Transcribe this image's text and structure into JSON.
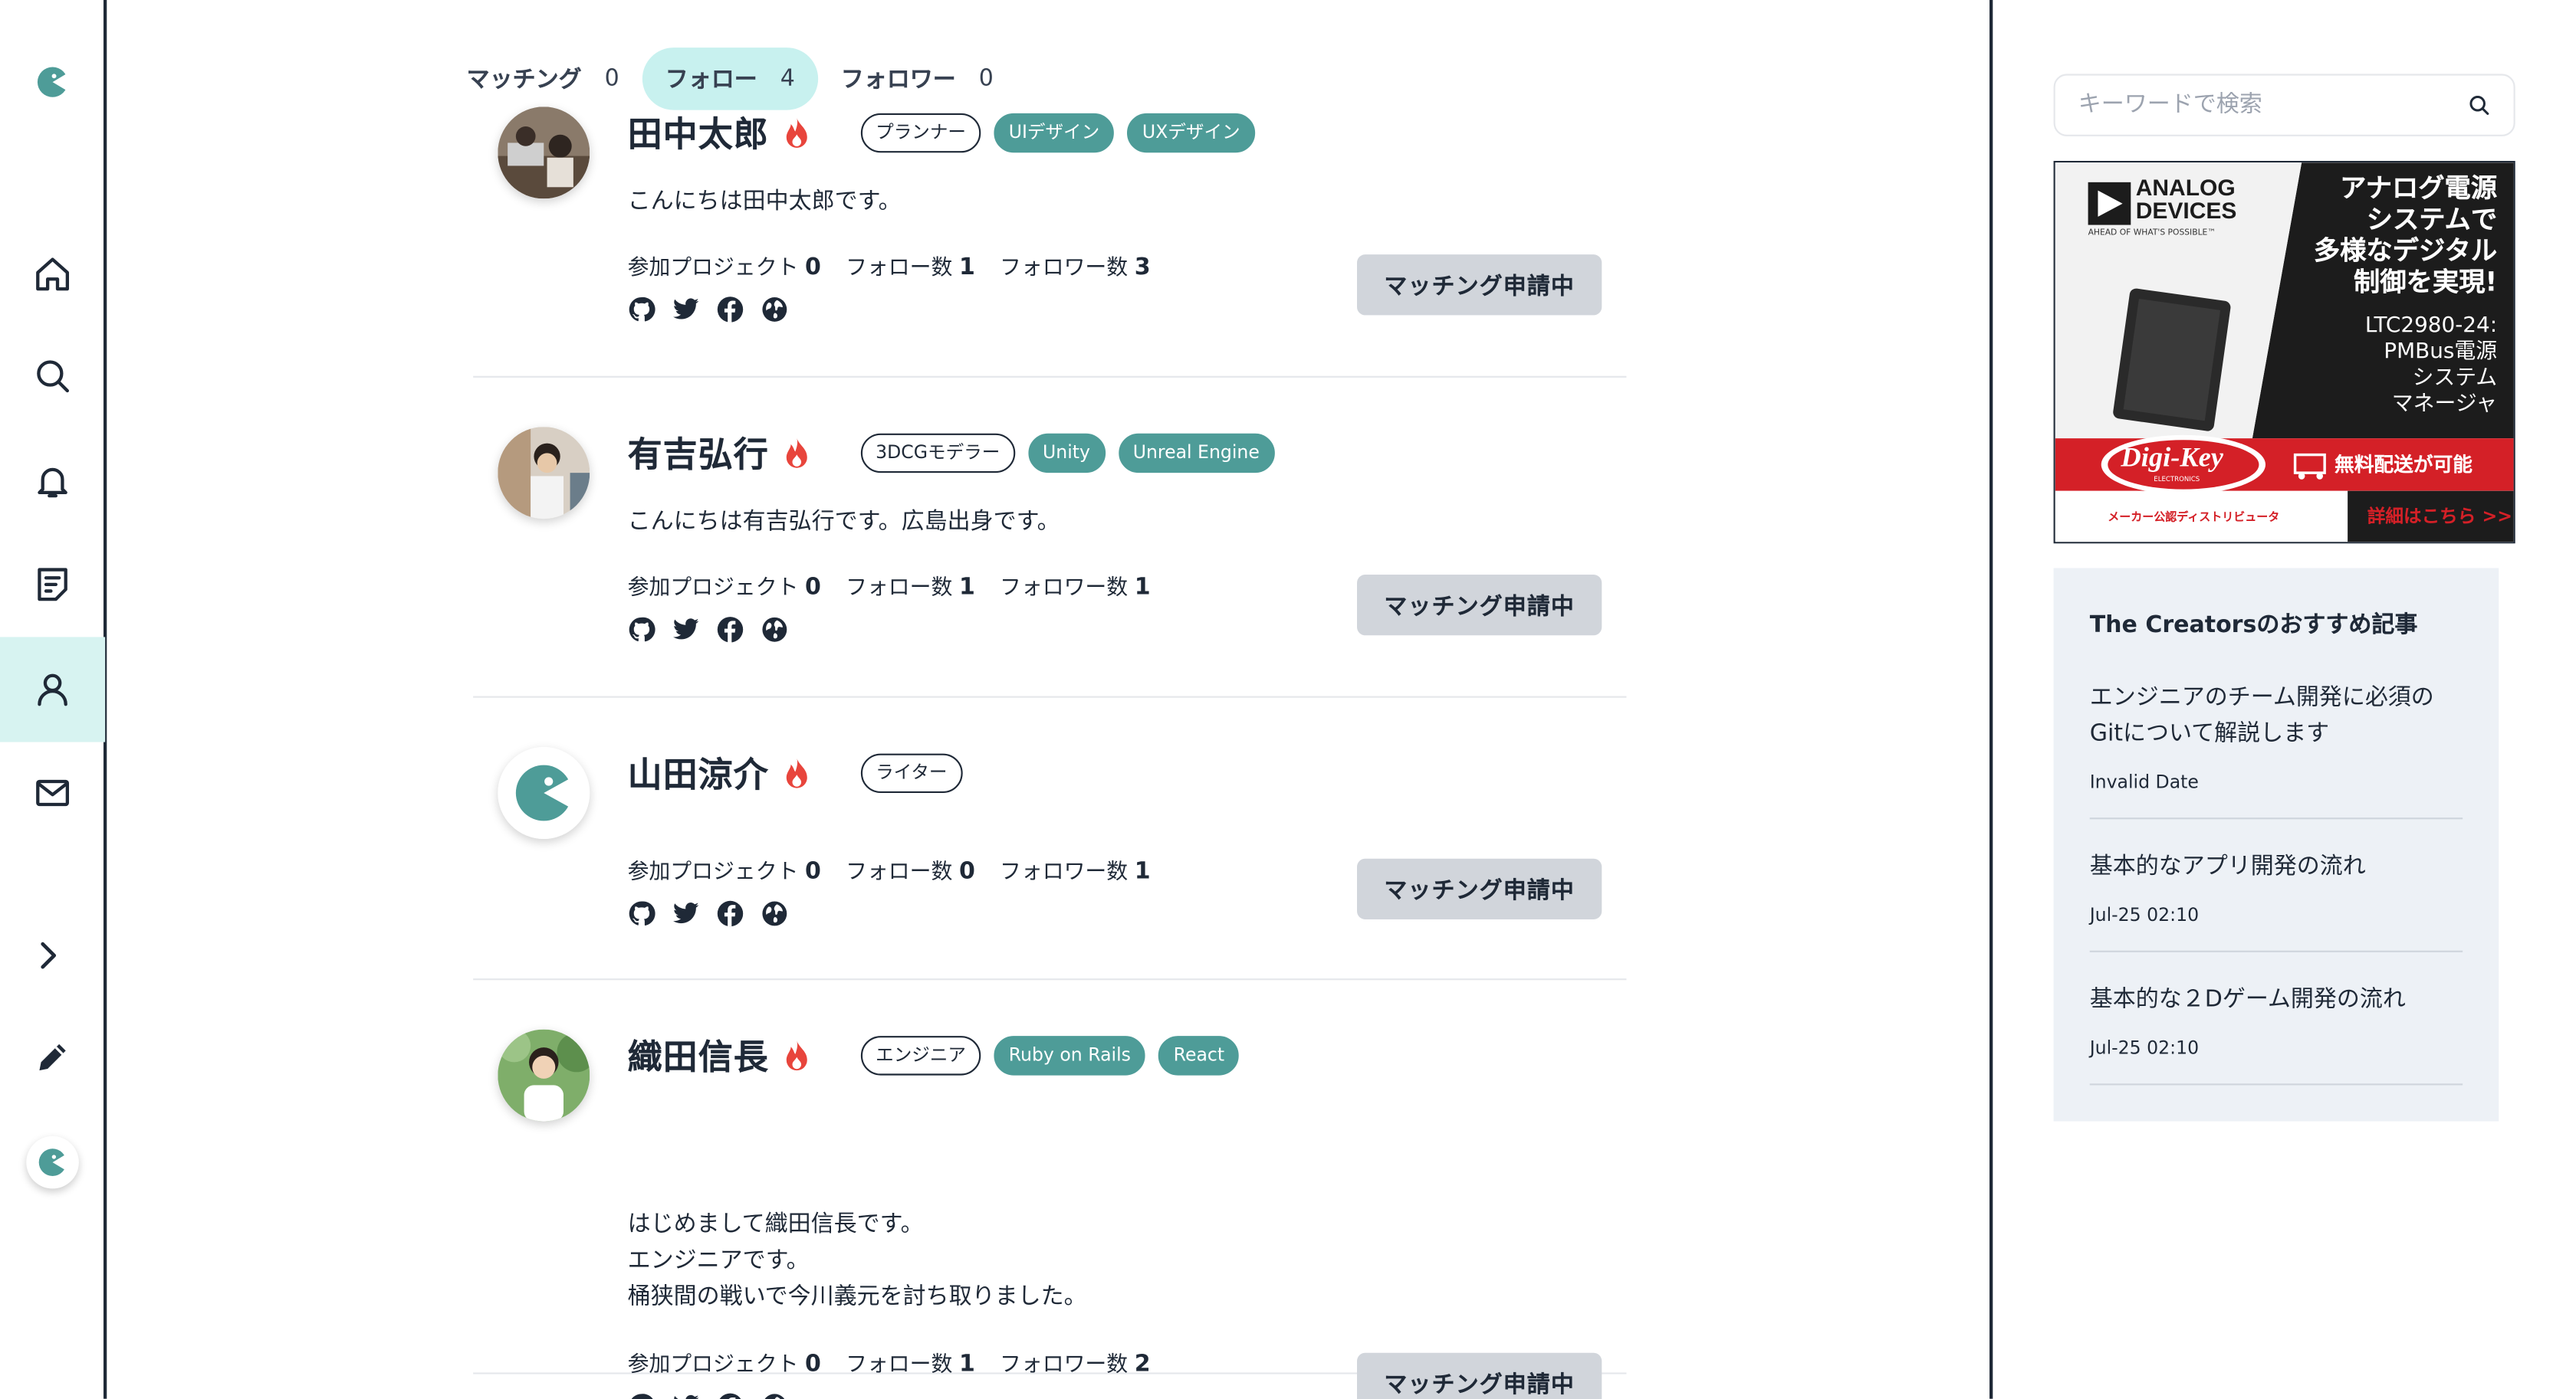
{
  "tabs": [
    {
      "label": "マッチング",
      "count": "0"
    },
    {
      "label": "フォロー",
      "count": "4"
    },
    {
      "label": "フォロワー",
      "count": "0"
    }
  ],
  "stat_labels": {
    "projects": "参加プロジェクト",
    "follows": "フォロー数",
    "followers": "フォロワー数"
  },
  "users": [
    {
      "name": "田中太郎",
      "roles": [
        "プランナー"
      ],
      "skills": [
        "UIデザイン",
        "UXデザイン"
      ],
      "bio": "こんにちは田中太郎です。",
      "projects": "0",
      "follows": "1",
      "followers": "3",
      "button": "マッチング申請中"
    },
    {
      "name": "有吉弘行",
      "roles": [
        "3DCGモデラー"
      ],
      "skills": [
        "Unity",
        "Unreal Engine"
      ],
      "bio": "こんにちは有吉弘行です。広島出身です。",
      "projects": "0",
      "follows": "1",
      "followers": "1",
      "button": "マッチング申請中"
    },
    {
      "name": "山田涼介",
      "roles": [
        "ライター"
      ],
      "skills": [],
      "bio": "",
      "projects": "0",
      "follows": "0",
      "followers": "1",
      "button": "マッチング申請中"
    },
    {
      "name": "織田信長",
      "roles": [
        "エンジニア"
      ],
      "skills": [
        "Ruby on Rails",
        "React"
      ],
      "bio": "はじめまして織田信長です。\nエンジニアです。\n桶狭間の戦いで今川義元を討ち取りました。",
      "projects": "0",
      "follows": "1",
      "followers": "2",
      "button": "マッチング申請中"
    }
  ],
  "search": {
    "placeholder": "キーワードで検索"
  },
  "ad": {
    "brand_line1": "ANALOG",
    "brand_line2": "DEVICES",
    "brand_tagline": "AHEAD OF WHAT'S POSSIBLE™",
    "headline1": "アナログ電源",
    "headline2": "システムで",
    "headline3": "多様なデジタル",
    "headline4": "制御を実現!",
    "product1": "LTC2980-24:",
    "product2": "PMBus電源",
    "product3": "システム",
    "product4": "マネージャ",
    "distributor": "Digi-Key",
    "distributor_sub": "ELECTRONICS",
    "shipping": "無料配送が可能",
    "footer_left": "メーカー公認ディストリビュータ",
    "footer_right": "詳細はこちら >>"
  },
  "recommend": {
    "title": "The Creatorsのおすすめ記事",
    "items": [
      {
        "title": "エンジニアのチーム開発に必須のGitについて解説します",
        "date": "Invalid Date"
      },
      {
        "title": "基本的なアプリ開発の流れ",
        "date": "Jul-25 02:10"
      },
      {
        "title": "基本的な２Dゲーム開発の流れ",
        "date": "Jul-25 02:10"
      }
    ]
  },
  "colors": {
    "accent": "#4e9c98",
    "active_tab": "#c8f1ef",
    "button_bg": "#d1d5db",
    "flame": "#e8453c"
  }
}
